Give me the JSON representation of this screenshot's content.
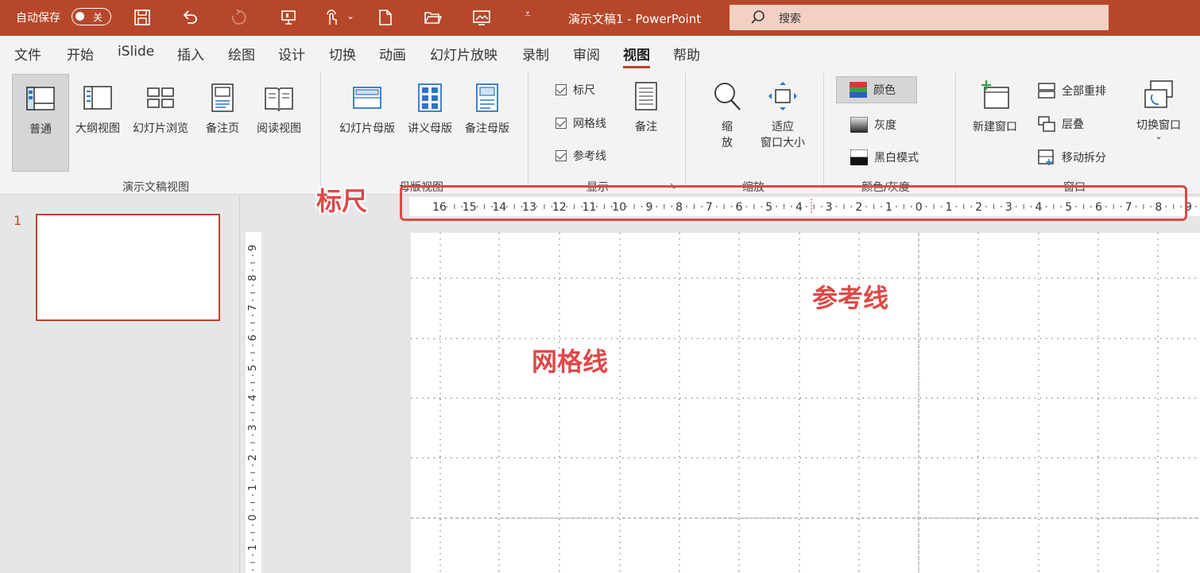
{
  "titlebar": {
    "autosave_label": "自动保存",
    "autosave_state": "关",
    "doc_title": "演示文稿1 - PowerPoint",
    "search_label": "搜索",
    "icons": [
      "save-icon",
      "undo-icon",
      "redo-icon",
      "present-icon",
      "touch-mode-icon",
      "new-file-icon",
      "open-folder-icon",
      "screenshot-icon",
      "customize-qat-icon"
    ]
  },
  "tabs": [
    {
      "label": "文件"
    },
    {
      "label": "开始"
    },
    {
      "label": "iSlide"
    },
    {
      "label": "插入"
    },
    {
      "label": "绘图"
    },
    {
      "label": "设计"
    },
    {
      "label": "切换"
    },
    {
      "label": "动画"
    },
    {
      "label": "幻灯片放映"
    },
    {
      "label": "录制"
    },
    {
      "label": "审阅"
    },
    {
      "label": "视图",
      "active": true
    },
    {
      "label": "帮助"
    }
  ],
  "ribbon": {
    "views": {
      "label": "演示文稿视图",
      "buttons": [
        {
          "label": "普通",
          "icon": "normal-view-icon"
        },
        {
          "label": "大纲视图",
          "icon": "outline-view-icon"
        },
        {
          "label": "幻灯片浏览",
          "icon": "slide-sorter-icon"
        },
        {
          "label": "备注页",
          "icon": "notes-page-icon"
        },
        {
          "label": "阅读视图",
          "icon": "reading-view-icon"
        }
      ]
    },
    "master": {
      "label": "母版视图",
      "buttons": [
        {
          "label": "幻灯片母版",
          "icon": "slide-master-icon"
        },
        {
          "label": "讲义母版",
          "icon": "handout-master-icon"
        },
        {
          "label": "备注母版",
          "icon": "notes-master-icon"
        }
      ]
    },
    "show": {
      "label": "显示",
      "checks": [
        {
          "label": "标尺",
          "checked": true
        },
        {
          "label": "网格线",
          "checked": true
        },
        {
          "label": "参考线",
          "checked": true
        }
      ],
      "notes_label": "备注"
    },
    "zoom": {
      "label": "缩放",
      "zoom_label_1": "缩",
      "zoom_label_2": "放",
      "fit_label_1": "适应",
      "fit_label_2": "窗口大小"
    },
    "color": {
      "label": "颜色/灰度",
      "items": [
        {
          "label": "颜色"
        },
        {
          "label": "灰度"
        },
        {
          "label": "黑白模式"
        }
      ]
    },
    "window": {
      "label": "窗口",
      "new_window": "新建窗口",
      "arrange_all": "全部重排",
      "cascade": "层叠",
      "move_split": "移动拆分",
      "switch_windows": "切换窗口"
    }
  },
  "thumbnails": [
    {
      "number": "1"
    }
  ],
  "rulers": {
    "horizontal": [
      "16",
      "15",
      "14",
      "13",
      "12",
      "11",
      "10",
      "9",
      "8",
      "7",
      "6",
      "5",
      "4",
      "3",
      "2",
      "1",
      "0",
      "1",
      "2",
      "3",
      "4",
      "5",
      "6",
      "7",
      "8",
      "9"
    ],
    "vertical": [
      "9",
      "8",
      "7",
      "6",
      "5",
      "4",
      "3",
      "2",
      "1",
      "0",
      "1"
    ]
  },
  "annotations": {
    "ruler": "标尺",
    "guides": "参考线",
    "gridlines": "网格线"
  },
  "colors": {
    "accent": "#b7472a",
    "annotation": "#e04848"
  }
}
